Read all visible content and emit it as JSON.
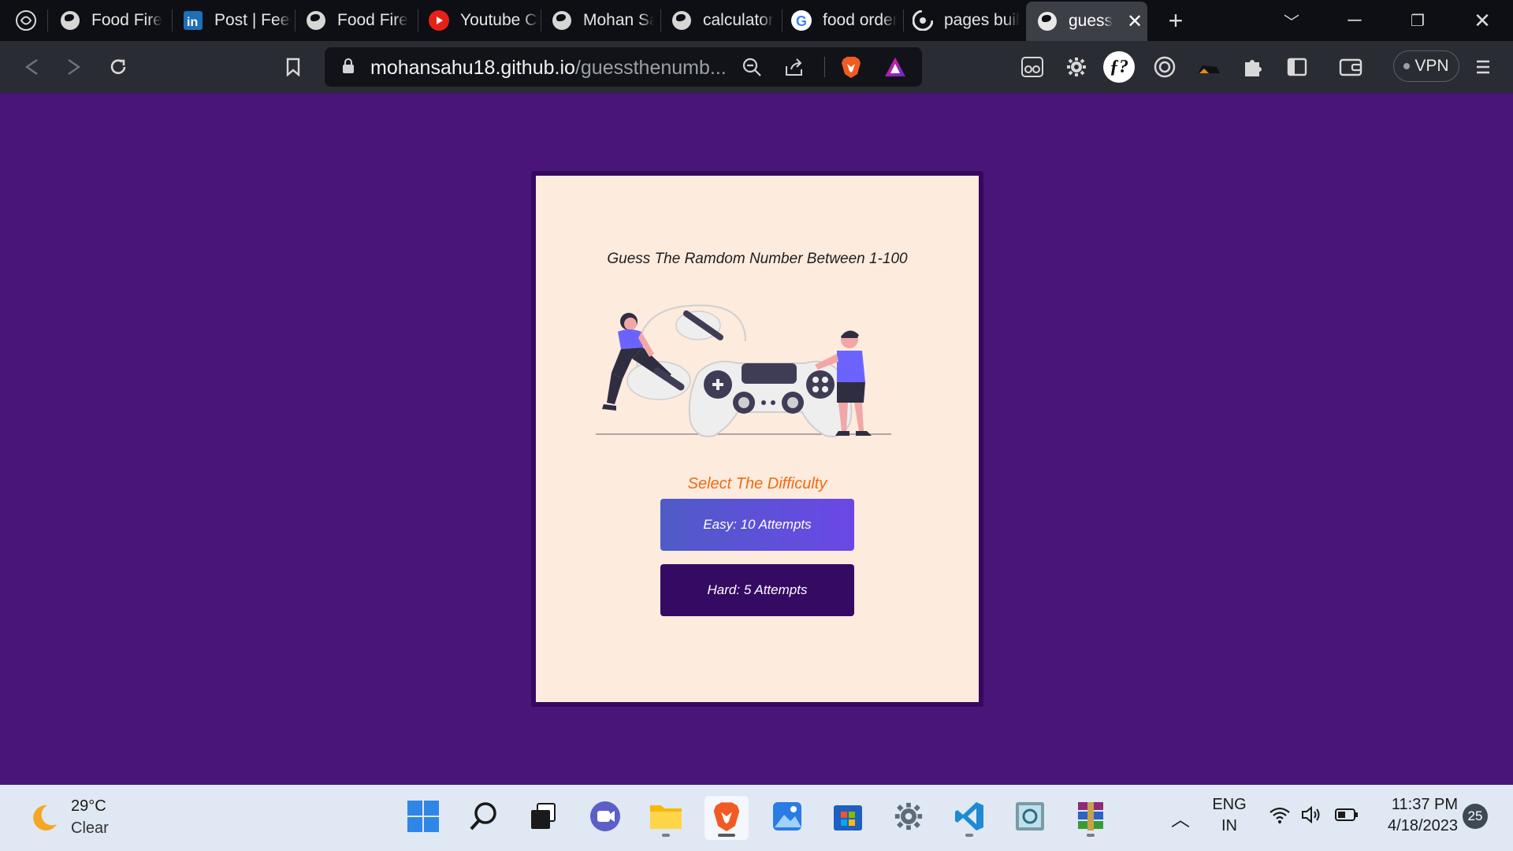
{
  "browser": {
    "tabs": [
      {
        "title": "Food Fire",
        "icon": "globe-icon"
      },
      {
        "title": "Post | Feed",
        "icon": "linkedin-icon"
      },
      {
        "title": "Food Fire",
        "icon": "globe-icon"
      },
      {
        "title": "Youtube Clone",
        "icon": "youtube-icon"
      },
      {
        "title": "Mohan Sahu",
        "icon": "globe-icon"
      },
      {
        "title": "calculator",
        "icon": "globe-icon"
      },
      {
        "title": "food order",
        "icon": "google-icon"
      },
      {
        "title": "pages build",
        "icon": "github-icon"
      },
      {
        "title": "guess",
        "icon": "globe-icon"
      }
    ],
    "url_host": "mohansahu18.github.io",
    "url_path": "/guessthenumb...",
    "vpn_label": "VPN"
  },
  "game": {
    "title": "Guess The Ramdom Number Between 1-100",
    "difficulty_label": "Select The Difficulty",
    "easy_label": "Easy: 10 Attempts",
    "hard_label": "Hard: 5 Attempts"
  },
  "taskbar": {
    "temperature": "29°C",
    "condition": "Clear",
    "language_line1": "ENG",
    "language_line2": "IN",
    "time": "11:37 PM",
    "date": "4/18/2023",
    "notification_count": "25"
  },
  "colors": {
    "page_background": "#4a1578",
    "card_background": "#fdebde",
    "card_border": "#36095e",
    "difficulty_text": "#f36a0f",
    "easy_button": "#5b53d9",
    "hard_button": "#350a63"
  }
}
